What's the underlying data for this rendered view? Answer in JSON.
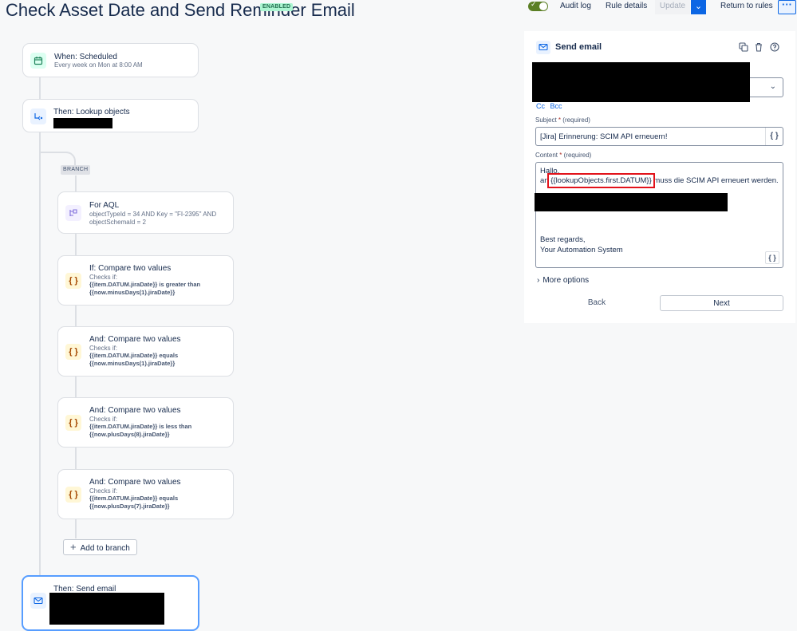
{
  "header": {
    "title": "Check Asset Date and Send Reminder Email",
    "badge": "ENABLED",
    "audit_log": "Audit log",
    "rule_details": "Rule details",
    "update": "Update",
    "return_to_rules": "Return to rules",
    "more": "···",
    "toggle_state": "on"
  },
  "flow": {
    "trigger": {
      "title": "When: Scheduled",
      "subtitle": "Every week on Mon at 8:00 AM",
      "icon": "calendar-icon"
    },
    "lookup": {
      "title": "Then: Lookup objects",
      "icon": "lookup-icon"
    },
    "branch_label": "BRANCH",
    "branch_items": [
      {
        "title": "For AQL",
        "line1": "objectTypeId = 34 AND Key = \"FI-2395\" AND",
        "line2": "objectSchemaId = 2",
        "icon": "branch-icon"
      },
      {
        "title": "If: Compare two values",
        "checks": "Checks if:",
        "line1": "{{item.DATUM.jiraDate}} is greater than",
        "line2": "{{now.minusDays(1).jiraDate}}",
        "icon": "curly-braces-icon"
      },
      {
        "title": "And: Compare two values",
        "checks": "Checks if:",
        "line1": "{{item.DATUM.jiraDate}} equals",
        "line2": "{{now.minusDays(1).jiraDate}}",
        "icon": "curly-braces-icon"
      },
      {
        "title": "And: Compare two values",
        "checks": "Checks if:",
        "line1": "{{item.DATUM.jiraDate}} is less than",
        "line2": "{{now.plusDays(8).jiraDate}}",
        "icon": "curly-braces-icon"
      },
      {
        "title": "And: Compare two values",
        "checks": "Checks if:",
        "line1": "{{item.DATUM.jiraDate}} equals",
        "line2": "{{now.plusDays(7).jiraDate}}",
        "icon": "curly-braces-icon"
      }
    ],
    "add_to_branch": "Add to branch",
    "send_email": {
      "title": "Then: Send email",
      "icon": "mail-icon"
    }
  },
  "panel": {
    "title": "Send email",
    "cc": "Cc",
    "bcc": "Bcc",
    "subject_label": "Subject",
    "required_mark": "*",
    "required_hint": "(required)",
    "subject_value": "[Jira] Erinnerung: SCIM API erneuern!",
    "content_label": "Content",
    "content": {
      "line1": "Hallo,",
      "line2_prefix": "an",
      "line2_var": "{{lookupObjects.first.DATUM}}",
      "line2_suffix": "muss die SCIM API erneuert werden.",
      "regards": "Best regards,",
      "signature": "Your Automation System"
    },
    "more_options": "More options",
    "back": "Back",
    "next": "Next"
  },
  "colors": {
    "accent": "#0c66e4",
    "highlight_box": "#e2121b",
    "redaction": "#000000",
    "enabled_badge_bg": "#abf5d1"
  }
}
